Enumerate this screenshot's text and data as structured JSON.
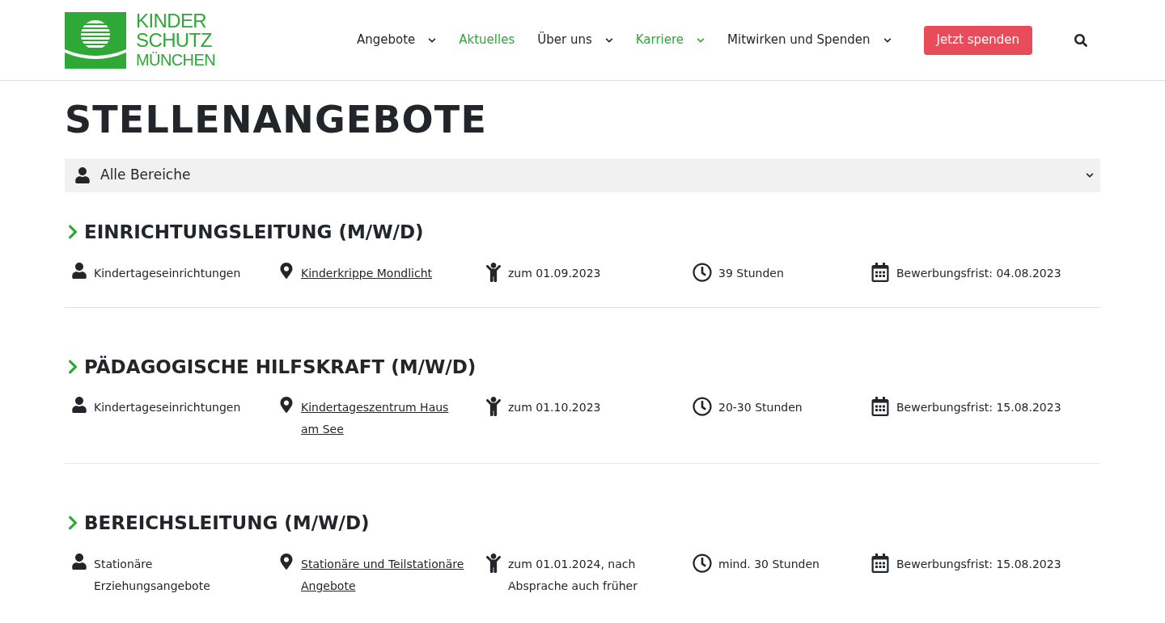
{
  "logo": {
    "lines": [
      "KINDER",
      "SCHUTZ",
      "MÜNCHEN"
    ]
  },
  "nav": [
    {
      "label": "Angebote",
      "dropdown": true,
      "selected": false
    },
    {
      "label": "Aktuelles",
      "dropdown": false,
      "selected": true
    },
    {
      "label": "Über uns",
      "dropdown": true,
      "selected": false
    },
    {
      "label": "Karriere",
      "dropdown": true,
      "selected": true
    },
    {
      "label": "Mitwirken und Spenden",
      "dropdown": true,
      "selected": false
    }
  ],
  "donate_button": "Jetzt spenden",
  "page_title": "STELLENANGEBOTE",
  "filter": {
    "value": "Alle Bereiche"
  },
  "jobs": [
    {
      "title": "EINRICHTUNGSLEITUNG (M/W/D)",
      "details": [
        {
          "kind": "area",
          "text": "Kindertageseinrichtungen"
        },
        {
          "kind": "location",
          "text": "Kinderkrippe Mondlicht"
        },
        {
          "kind": "start",
          "text": "zum 01.09.2023"
        },
        {
          "kind": "hours",
          "text": "39 Stunden"
        },
        {
          "kind": "deadline",
          "text": "Bewerbungsfrist: 04.08.2023"
        }
      ]
    },
    {
      "title": "PÄDAGOGISCHE HILFSKRAFT (M/W/D)",
      "details": [
        {
          "kind": "area",
          "text": "Kindertageseinrichtungen"
        },
        {
          "kind": "location",
          "text": "Kindertageszentrum Haus am See"
        },
        {
          "kind": "start",
          "text": "zum 01.10.2023"
        },
        {
          "kind": "hours",
          "text": "20-30 Stunden"
        },
        {
          "kind": "deadline",
          "text": "Bewerbungsfrist: 15.08.2023"
        }
      ]
    },
    {
      "title": "BEREICHSLEITUNG (M/W/D)",
      "details": [
        {
          "kind": "area",
          "text": "Stationäre Erziehungsangebote"
        },
        {
          "kind": "location",
          "text": "Stationäre und Teilstationäre Angebote"
        },
        {
          "kind": "start",
          "text": "zum 01.01.2024, nach Absprache auch früher"
        },
        {
          "kind": "hours",
          "text": "mind. 30 Stunden"
        },
        {
          "kind": "deadline",
          "text": "Bewerbungsfrist: 15.08.2023"
        }
      ]
    }
  ]
}
